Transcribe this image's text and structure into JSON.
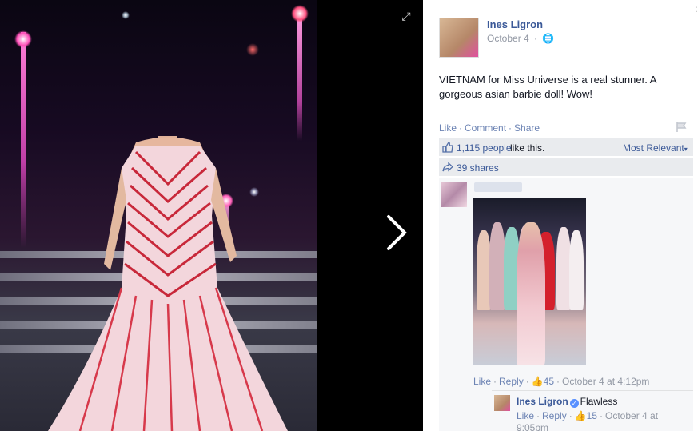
{
  "post": {
    "author": "Ines Ligron",
    "date": "October 4",
    "privacy_icon": "globe-icon",
    "text": "VIETNAM for Miss Universe is a real stunner. A gorgeous asian barbie doll! Wow!"
  },
  "actions": {
    "like": "Like",
    "comment": "Comment",
    "share": "Share",
    "separator": "·"
  },
  "likes": {
    "count": "1,115 people",
    "suffix": "like this.",
    "sort": "Most Relevant"
  },
  "shares": {
    "count": "39 shares"
  },
  "comments": [
    {
      "like": "Like",
      "reply": "Reply",
      "likes": "45",
      "time": "October 4 at 4:12pm"
    },
    {
      "author": "Ines Ligron",
      "text": "Flawless",
      "like": "Like",
      "reply": "Reply",
      "likes": "15",
      "time": "October 4 at 9:05pm"
    }
  ],
  "colors": {
    "link": "#3b5998",
    "meta": "#9197a3",
    "panel_bg": "#e9ebee",
    "viewer_bg": "#000000"
  }
}
